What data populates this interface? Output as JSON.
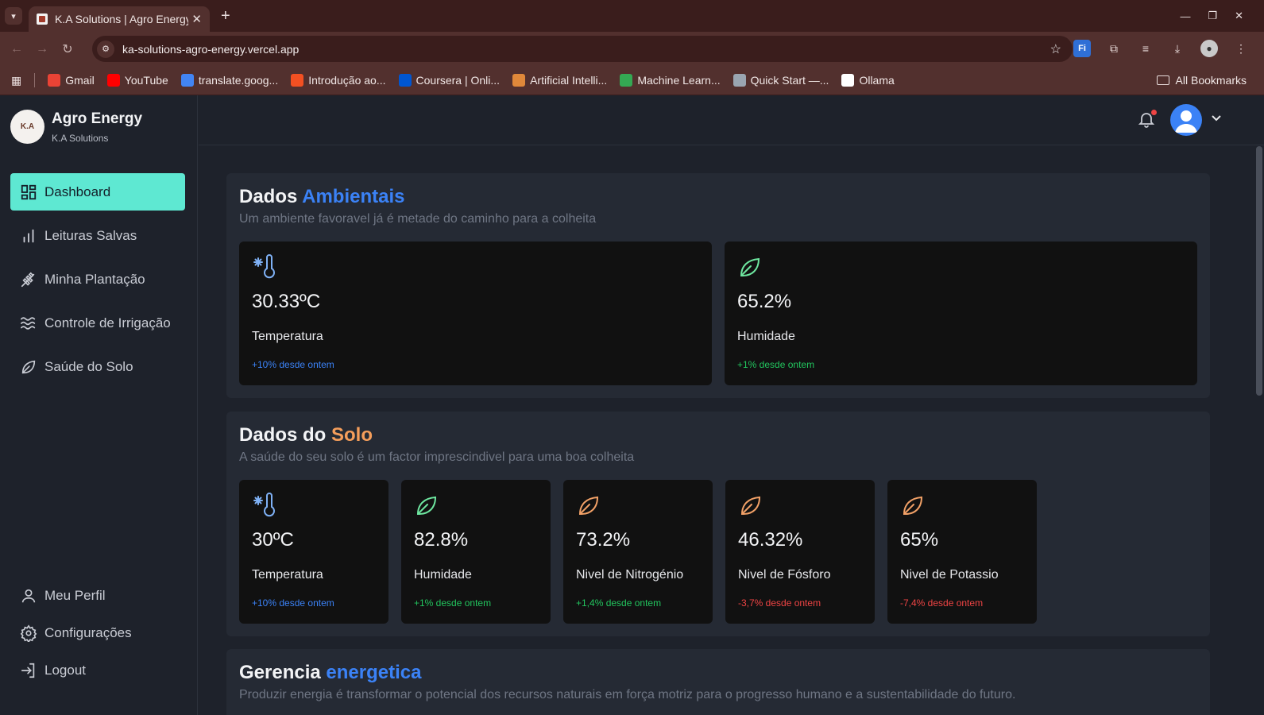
{
  "browser": {
    "tab_title": "K.A Solutions | Agro Energy",
    "url": "ka-solutions-agro-energy.vercel.app",
    "extension_fi": "Fi",
    "bookmarks": [
      {
        "label": "Gmail",
        "color": "#ea4335"
      },
      {
        "label": "YouTube",
        "color": "#ff0000"
      },
      {
        "label": "translate.goog...",
        "color": "#4285f4"
      },
      {
        "label": "Introdução ao...",
        "color": "#f25022"
      },
      {
        "label": "Coursera | Onli...",
        "color": "#0056d2"
      },
      {
        "label": "Artificial Intelli...",
        "color": "#e0883a"
      },
      {
        "label": "Machine Learn...",
        "color": "#34a853"
      },
      {
        "label": "Quick Start —...",
        "color": "#9aa5b1"
      },
      {
        "label": "Ollama",
        "color": "#ffffff"
      }
    ],
    "all_bookmarks": "All Bookmarks"
  },
  "brand": {
    "title": "Agro Energy",
    "subtitle": "K.A Solutions",
    "logo_text": "K.A"
  },
  "nav": {
    "items": [
      {
        "label": "Dashboard",
        "icon": "dashboard-icon",
        "active": true
      },
      {
        "label": "Leituras Salvas",
        "icon": "bar-chart-icon"
      },
      {
        "label": "Minha Plantação",
        "icon": "wheat-icon"
      },
      {
        "label": "Controle de Irrigação",
        "icon": "waves-icon"
      },
      {
        "label": "Saúde do Solo",
        "icon": "leaf-icon"
      }
    ],
    "bottom": [
      {
        "label": "Meu Perfil",
        "icon": "user-icon"
      },
      {
        "label": "Configurações",
        "icon": "gear-icon"
      },
      {
        "label": "Logout",
        "icon": "logout-icon"
      }
    ]
  },
  "sections": {
    "ambiental": {
      "title_prefix": "Dados ",
      "title_accent": "Ambientais",
      "subtitle": "Um ambiente favoravel já é metade do caminho para a colheita",
      "cards": [
        {
          "value": "30.33ºC",
          "label": "Temperatura",
          "delta": "+10% desde ontem",
          "icon": "thermometer-snow-icon"
        },
        {
          "value": "65.2%",
          "label": "Humidade",
          "delta": "+1% desde ontem",
          "icon": "leaf-icon"
        }
      ]
    },
    "solo": {
      "title_prefix": "Dados do ",
      "title_accent": "Solo",
      "subtitle": "A saúde do seu solo é um factor imprescindivel para uma boa colheita",
      "cards": [
        {
          "value": "30ºC",
          "label": "Temperatura",
          "delta": "+10% desde ontem",
          "icon": "thermometer-snow-icon"
        },
        {
          "value": "82.8%",
          "label": "Humidade",
          "delta": "+1% desde ontem",
          "icon": "leaf-icon"
        },
        {
          "value": "73.2%",
          "label": "Nivel de Nitrogénio",
          "delta": "+1,4% desde ontem",
          "icon": "leaf-icon"
        },
        {
          "value": "46.32%",
          "label": "Nivel de Fósforo",
          "delta": "-3,7% desde ontem",
          "icon": "leaf-icon"
        },
        {
          "value": "65%",
          "label": "Nivel de Potassio",
          "delta": "-7,4% desde ontem",
          "icon": "leaf-icon"
        }
      ]
    },
    "energia": {
      "title_prefix": "Gerencia ",
      "title_accent": "energetica",
      "subtitle": "Produzir energia é transformar o potencial dos recursos naturais em força motriz para o progresso humano e a sustentabilidade do futuro."
    }
  },
  "colors": {
    "accent": "#5ee8d2",
    "blue": "#3b82f6",
    "green": "#22c55e",
    "red": "#ef4444",
    "orange": "#f59e5b",
    "card_bg": "#111111"
  }
}
